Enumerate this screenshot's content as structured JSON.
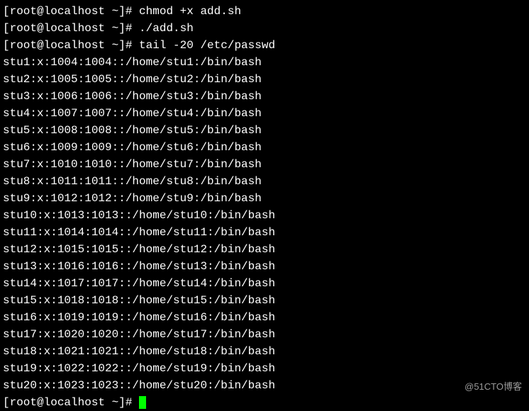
{
  "prompt": {
    "user": "root",
    "host": "localhost",
    "path": "~",
    "symbol": "#"
  },
  "commands": [
    {
      "text": "chmod +x add.sh"
    },
    {
      "text": "./add.sh"
    },
    {
      "text": "tail -20 /etc/passwd"
    }
  ],
  "output_lines": [
    "stu1:x:1004:1004::/home/stu1:/bin/bash",
    "stu2:x:1005:1005::/home/stu2:/bin/bash",
    "stu3:x:1006:1006::/home/stu3:/bin/bash",
    "stu4:x:1007:1007::/home/stu4:/bin/bash",
    "stu5:x:1008:1008::/home/stu5:/bin/bash",
    "stu6:x:1009:1009::/home/stu6:/bin/bash",
    "stu7:x:1010:1010::/home/stu7:/bin/bash",
    "stu8:x:1011:1011::/home/stu8:/bin/bash",
    "stu9:x:1012:1012::/home/stu9:/bin/bash",
    "stu10:x:1013:1013::/home/stu10:/bin/bash",
    "stu11:x:1014:1014::/home/stu11:/bin/bash",
    "stu12:x:1015:1015::/home/stu12:/bin/bash",
    "stu13:x:1016:1016::/home/stu13:/bin/bash",
    "stu14:x:1017:1017::/home/stu14:/bin/bash",
    "stu15:x:1018:1018::/home/stu15:/bin/bash",
    "stu16:x:1019:1019::/home/stu16:/bin/bash",
    "stu17:x:1020:1020::/home/stu17:/bin/bash",
    "stu18:x:1021:1021::/home/stu18:/bin/bash",
    "stu19:x:1022:1022::/home/stu19:/bin/bash",
    "stu20:x:1023:1023::/home/stu20:/bin/bash"
  ],
  "final_prompt": {
    "present": true
  },
  "watermark": "@51CTO博客"
}
